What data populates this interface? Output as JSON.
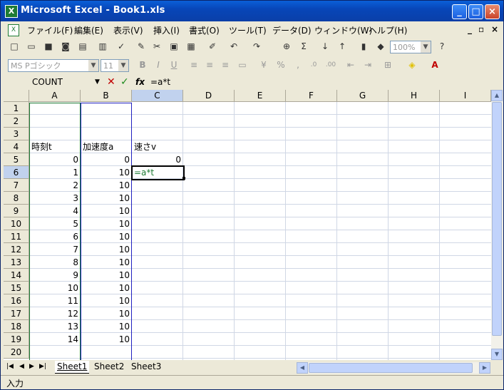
{
  "window": {
    "title": "Microsoft Excel - Book1.xls"
  },
  "menu": [
    {
      "label": "ファイル(F)"
    },
    {
      "label": "編集(E)"
    },
    {
      "label": "表示(V)"
    },
    {
      "label": "挿入(I)"
    },
    {
      "label": "書式(O)"
    },
    {
      "label": "ツール(T)"
    },
    {
      "label": "データ(D)"
    },
    {
      "label": "ウィンドウ(W)"
    },
    {
      "label": "ヘルプ(H)"
    }
  ],
  "toolbar": {
    "zoom": "100%",
    "font_name": "MS Pゴシック",
    "font_size": "11"
  },
  "formula_bar": {
    "name_box": "COUNT",
    "formula": "=a*t"
  },
  "columns": [
    "A",
    "B",
    "C",
    "D",
    "E",
    "F",
    "G",
    "H",
    "I"
  ],
  "rows": [
    "1",
    "2",
    "3",
    "4",
    "5",
    "6",
    "7",
    "8",
    "9",
    "10",
    "11",
    "12",
    "13",
    "14",
    "15",
    "16",
    "17",
    "18",
    "19",
    "20"
  ],
  "cells": {
    "A4": "時刻t",
    "B4": "加速度a",
    "C4": "速さv",
    "A5": "0",
    "B5": "0",
    "C5": "0",
    "A6": "1",
    "B6": "10",
    "C6": "=a*t",
    "A7": "2",
    "B7": "10",
    "A8": "3",
    "B8": "10",
    "A9": "4",
    "B9": "10",
    "A10": "5",
    "B10": "10",
    "A11": "6",
    "B11": "10",
    "A12": "7",
    "B12": "10",
    "A13": "8",
    "B13": "10",
    "A14": "9",
    "B14": "10",
    "A15": "10",
    "B15": "10",
    "A16": "11",
    "B16": "10",
    "A17": "12",
    "B17": "10",
    "A18": "13",
    "B18": "10",
    "A19": "14",
    "B19": "10"
  },
  "sheets": [
    "Sheet1",
    "Sheet2",
    "Sheet3"
  ],
  "status": "入力",
  "colors": {
    "range_a_border": "#1e7b34",
    "range_b_border": "#2020c0",
    "title_bar": "#0a5fd8"
  }
}
